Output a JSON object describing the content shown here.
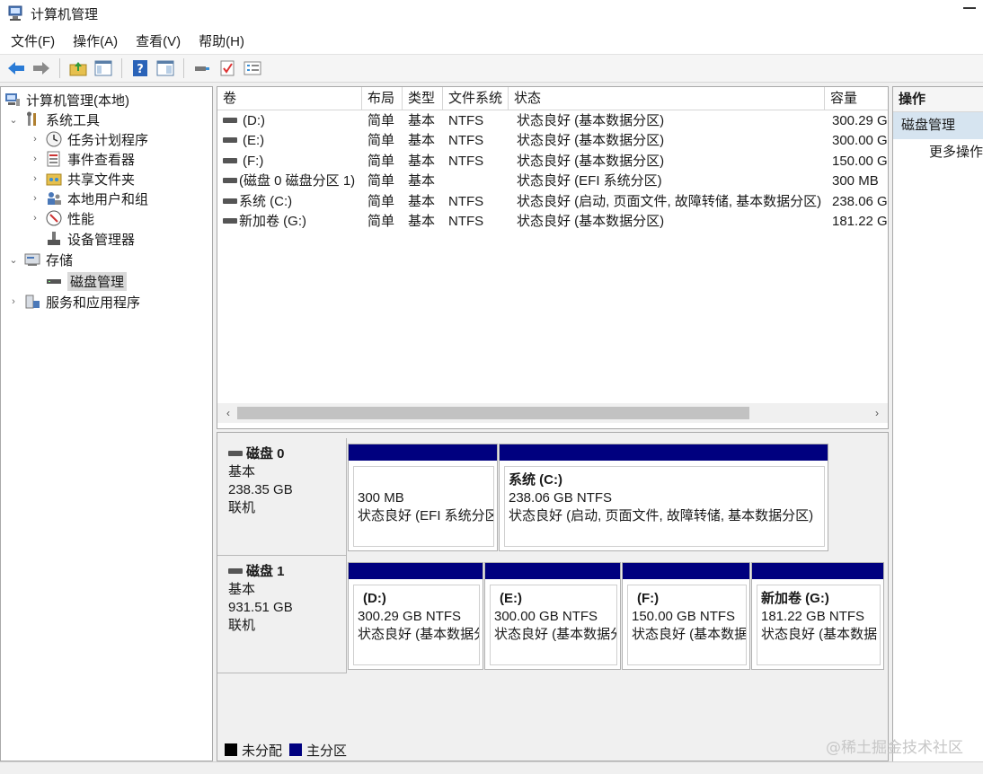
{
  "window": {
    "title": "计算机管理"
  },
  "menu": [
    "文件(F)",
    "操作(A)",
    "查看(V)",
    "帮助(H)"
  ],
  "toolbar": [
    "back-arrow-icon",
    "forward-arrow-icon",
    "up-folder-icon",
    "show-hide-tree-icon",
    "help-icon",
    "properties-view-icon",
    "connect-icon",
    "check-icon",
    "list-settings-icon"
  ],
  "tree": {
    "root": "计算机管理(本地)",
    "system_tools": "系统工具",
    "task_scheduler": "任务计划程序",
    "event_viewer": "事件查看器",
    "shared_folders": "共享文件夹",
    "local_users": "本地用户和组",
    "performance": "性能",
    "device_manager": "设备管理器",
    "storage": "存储",
    "disk_management": "磁盘管理",
    "services_apps": "服务和应用程序"
  },
  "volume_table": {
    "columns": [
      "卷",
      "布局",
      "类型",
      "文件系统",
      "状态",
      "容量"
    ],
    "rows": [
      {
        "vol": "(D:)",
        "layout": "简单",
        "type": "基本",
        "fs": "NTFS",
        "status": "状态良好 (基本数据分区)",
        "cap": "300.29 G"
      },
      {
        "vol": "(E:)",
        "layout": "简单",
        "type": "基本",
        "fs": "NTFS",
        "status": "状态良好 (基本数据分区)",
        "cap": "300.00 G"
      },
      {
        "vol": "(F:)",
        "layout": "简单",
        "type": "基本",
        "fs": "NTFS",
        "status": "状态良好 (基本数据分区)",
        "cap": "150.00 G"
      },
      {
        "vol": "(磁盘 0 磁盘分区 1)",
        "layout": "简单",
        "type": "基本",
        "fs": "",
        "status": "状态良好 (EFI 系统分区)",
        "cap": "300 MB"
      },
      {
        "vol": "系统 (C:)",
        "layout": "简单",
        "type": "基本",
        "fs": "NTFS",
        "status": "状态良好 (启动, 页面文件, 故障转储, 基本数据分区)",
        "cap": "238.06 G"
      },
      {
        "vol": "新加卷 (G:)",
        "layout": "简单",
        "type": "基本",
        "fs": "NTFS",
        "status": "状态良好 (基本数据分区)",
        "cap": "181.22 G"
      }
    ]
  },
  "disks": [
    {
      "name": "磁盘 0",
      "kind": "基本",
      "size": "238.35 GB",
      "state": "联机",
      "partitions": [
        {
          "name": "",
          "size_fs": "300 MB",
          "status": "状态良好 (EFI 系统分区"
        },
        {
          "name": "系统  (C:)",
          "size_fs": "238.06 GB NTFS",
          "status": "状态良好 (启动, 页面文件, 故障转储, 基本数据分区)"
        }
      ]
    },
    {
      "name": "磁盘 1",
      "kind": "基本",
      "size": "931.51 GB",
      "state": "联机",
      "partitions": [
        {
          "name": "(D:)",
          "size_fs": "300.29 GB NTFS",
          "status": "状态良好 (基本数据分"
        },
        {
          "name": "(E:)",
          "size_fs": "300.00 GB NTFS",
          "status": "状态良好 (基本数据分"
        },
        {
          "name": "(F:)",
          "size_fs": "150.00 GB NTFS",
          "status": "状态良好 (基本数据"
        },
        {
          "name": "新加卷  (G:)",
          "size_fs": "181.22 GB NTFS",
          "status": "状态良好 (基本数据"
        }
      ]
    }
  ],
  "legend": {
    "unallocated": "未分配",
    "primary": "主分区"
  },
  "colors": {
    "unallocated": "#000000",
    "primary": "#00007f",
    "selection": "#d6e4f0"
  },
  "actions": {
    "title": "操作",
    "section": "磁盘管理",
    "more": "更多操作"
  },
  "watermark": "@稀土掘金技术社区"
}
